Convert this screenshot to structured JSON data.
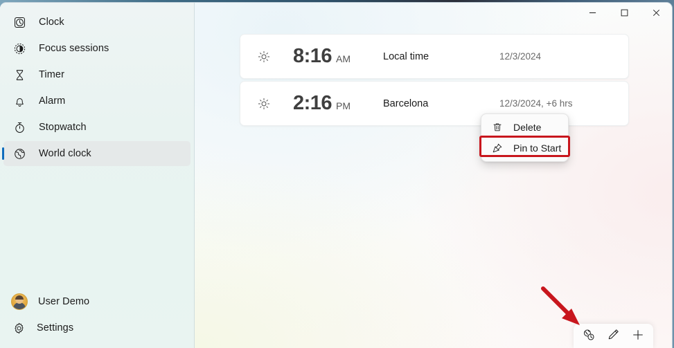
{
  "window": {
    "title": "Clock",
    "controls": [
      {
        "name": "minimize",
        "glyph": "minimize-icon"
      },
      {
        "name": "maximize",
        "glyph": "maximize-icon"
      },
      {
        "name": "close",
        "glyph": "close-icon"
      }
    ]
  },
  "sidebar": {
    "items": [
      {
        "label": "Clock",
        "icon": "clock-icon",
        "selected": false
      },
      {
        "label": "Focus sessions",
        "icon": "focus-sessions-icon",
        "selected": false
      },
      {
        "label": "Timer",
        "icon": "hourglass-icon",
        "selected": false
      },
      {
        "label": "Alarm",
        "icon": "bell-icon",
        "selected": false
      },
      {
        "label": "Stopwatch",
        "icon": "stopwatch-icon",
        "selected": false
      },
      {
        "label": "World clock",
        "icon": "globe-icon",
        "selected": true
      }
    ],
    "account": {
      "label": "User Demo",
      "icon": "avatar"
    },
    "settings": {
      "label": "Settings",
      "icon": "gear-icon"
    },
    "selected_accent": "#0f6cbd"
  },
  "main": {
    "clocks": [
      {
        "icon": "sun-icon",
        "time": "8:16",
        "meridiem": "AM",
        "place": "Local time",
        "date": "12/3/2024"
      },
      {
        "icon": "sun-icon",
        "time": "2:16",
        "meridiem": "PM",
        "place": "Barcelona",
        "date": "12/3/2024, +6 hrs"
      }
    ]
  },
  "context_menu": {
    "items": [
      {
        "label": "Delete",
        "icon": "trash-icon",
        "highlighted": false
      },
      {
        "label": "Pin to Start",
        "icon": "pin-icon",
        "highlighted": true
      }
    ],
    "highlight_color": "#c8161d"
  },
  "action_bar": {
    "buttons": [
      {
        "name": "compare-times",
        "icon": "compare-times-icon",
        "label": "Compare times"
      },
      {
        "name": "edit",
        "icon": "pencil-icon",
        "label": "Edit"
      },
      {
        "name": "add",
        "icon": "plus-icon",
        "label": "Add new city"
      }
    ]
  },
  "annotation": {
    "arrow_color": "#c8161d",
    "points_at": "compare-times"
  }
}
